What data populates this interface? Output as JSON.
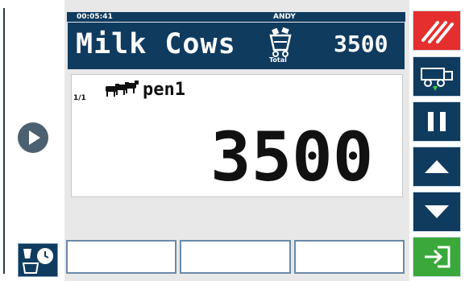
{
  "status": {
    "time": "00:05:41",
    "user": "ANDY"
  },
  "header": {
    "title": "Milk Cows",
    "total_label": "Total",
    "amount": "3500"
  },
  "card": {
    "pager": "1/1",
    "pen": "pen1",
    "value": "3500"
  },
  "colors": {
    "header_bg": "#0f3b5f",
    "stop_button": "#e52f2f",
    "confirm_button": "#3aa83a",
    "nav_circle": "#4b6070"
  },
  "icons": {
    "stop": "diagonal-stripes-icon",
    "feed_wagon": "feed-wagon-icon",
    "pause": "pause-icon",
    "up": "triangle-up-icon",
    "down": "triangle-down-icon",
    "confirm": "enter-arrow-icon",
    "play": "play-icon",
    "total": "mixer-bucket-icon",
    "cows": "cow-group-icon",
    "corner": "bucket-clock-icon"
  }
}
